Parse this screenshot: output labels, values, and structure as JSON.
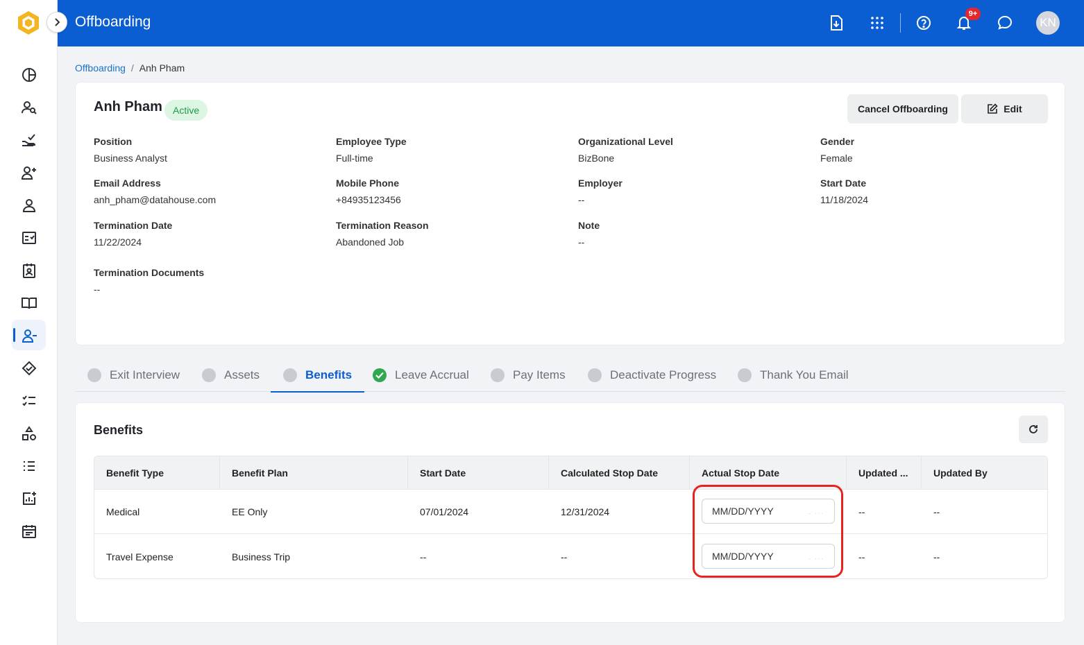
{
  "app": {
    "title": "Offboarding"
  },
  "header": {
    "notification_count": "9+",
    "avatar_initials": "KN",
    "icons": [
      "download-document-icon",
      "apps-grid-icon",
      "help-icon",
      "bell-icon",
      "chat-icon"
    ]
  },
  "sidebar": {
    "items": [
      "dashboard-icon",
      "people-search-icon",
      "hand-check-icon",
      "add-user-icon",
      "person-icon",
      "checklist-icon",
      "id-badge-icon",
      "book-icon",
      "offboarding-icon",
      "handshake-icon",
      "task-list-icon",
      "shapes-icon",
      "list-numbered-icon",
      "report-add-icon",
      "calendar-icon"
    ]
  },
  "breadcrumb": {
    "root": "Offboarding",
    "separator": "/",
    "current": "Anh Pham"
  },
  "profile": {
    "name": "Anh Pham",
    "status": "Active",
    "cancel_label": "Cancel Offboarding",
    "edit_label": "Edit",
    "fields": {
      "position": {
        "label": "Position",
        "value": "Business Analyst"
      },
      "employee_type": {
        "label": "Employee Type",
        "value": "Full-time"
      },
      "org_level": {
        "label": "Organizational Level",
        "value": "BizBone"
      },
      "gender": {
        "label": "Gender",
        "value": "Female"
      },
      "email": {
        "label": "Email Address",
        "value": "anh_pham@datahouse.com"
      },
      "mobile": {
        "label": "Mobile Phone",
        "value": "+84935123456"
      },
      "employer": {
        "label": "Employer",
        "value": "--"
      },
      "start_date": {
        "label": "Start Date",
        "value": "11/18/2024"
      },
      "termination_date": {
        "label": "Termination Date",
        "value": "11/22/2024"
      },
      "termination_reason": {
        "label": "Termination Reason",
        "value": "Abandoned Job"
      },
      "note": {
        "label": "Note",
        "value": "--"
      },
      "termination_documents": {
        "label": "Termination Documents",
        "value": "--"
      }
    }
  },
  "tabs": [
    {
      "label": "Exit Interview",
      "state": "pending"
    },
    {
      "label": "Assets",
      "state": "pending"
    },
    {
      "label": "Benefits",
      "state": "active"
    },
    {
      "label": "Leave Accrual",
      "state": "done"
    },
    {
      "label": "Pay Items",
      "state": "pending"
    },
    {
      "label": "Deactivate Progress",
      "state": "pending"
    },
    {
      "label": "Thank You Email",
      "state": "pending"
    }
  ],
  "benefits": {
    "title": "Benefits",
    "columns": [
      "Benefit Type",
      "Benefit Plan",
      "Start Date",
      "Calculated Stop Date",
      "Actual Stop Date",
      "Updated ...",
      "Updated By"
    ],
    "rows": [
      {
        "type": "Medical",
        "plan": "EE Only",
        "start": "07/01/2024",
        "calc_stop": "12/31/2024",
        "actual_stop_placeholder": "MM/DD/YYYY",
        "updated": "--",
        "updated_by": "--"
      },
      {
        "type": "Travel Expense",
        "plan": "Business Trip",
        "start": "--",
        "calc_stop": "--",
        "actual_stop_placeholder": "MM/DD/YYYY",
        "updated": "--",
        "updated_by": "--"
      }
    ]
  },
  "colors": {
    "primary": "#0a5ed1",
    "active_bg": "#dcf6e3",
    "active_text": "#209a46",
    "highlight": "#e8231f",
    "done": "#2fa84f"
  }
}
